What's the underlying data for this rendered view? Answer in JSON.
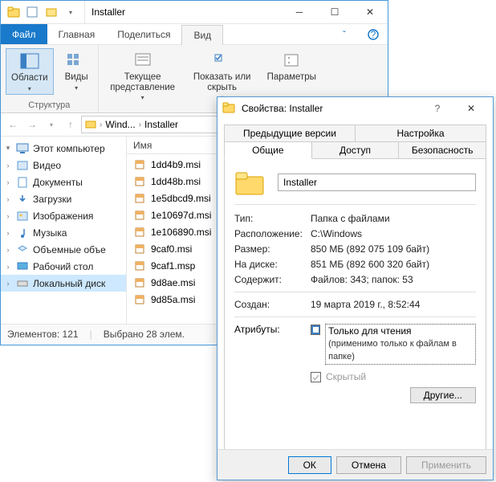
{
  "titlebar": {
    "title": "Installer"
  },
  "menu": {
    "file": "Файл",
    "tabs": [
      "Главная",
      "Поделиться",
      "Вид"
    ],
    "active_tab": 2
  },
  "ribbon": {
    "groups": [
      {
        "name": "Структура",
        "buttons": [
          {
            "label": "Области",
            "dd": true,
            "active": true
          },
          {
            "label": "Виды",
            "dd": true
          }
        ]
      },
      {
        "name": "",
        "buttons": [
          {
            "label": "Текущее представление",
            "dd": true
          },
          {
            "label": "Показать или скрыть",
            "dd": true
          },
          {
            "label": "Параметры",
            "dd": false
          }
        ]
      }
    ]
  },
  "breadcrumbs": [
    "Wind...",
    "Installer"
  ],
  "nav": [
    {
      "label": "Этот компьютер",
      "icon": "pc",
      "expand": "open"
    },
    {
      "label": "Видео",
      "icon": "video"
    },
    {
      "label": "Документы",
      "icon": "docs"
    },
    {
      "label": "Загрузки",
      "icon": "down"
    },
    {
      "label": "Изображения",
      "icon": "img"
    },
    {
      "label": "Музыка",
      "icon": "music"
    },
    {
      "label": "Объемные объе",
      "icon": "obj"
    },
    {
      "label": "Рабочий стол",
      "icon": "desk"
    },
    {
      "label": "Локальный диск",
      "icon": "disk",
      "sel": true
    }
  ],
  "column_header": "Имя",
  "files": [
    "1dd4b9.msi",
    "1dd48b.msi",
    "1e5dbcd9.msi",
    "1e10697d.msi",
    "1e106890.msi",
    "9caf0.msi",
    "9caf1.msp",
    "9d8ae.msi",
    "9d85a.msi"
  ],
  "status": {
    "elements": "Элементов: 121",
    "selected": "Выбрано 28 элем."
  },
  "props": {
    "title": "Свойства: Installer",
    "tabs_row1": [
      "Предыдущие версии",
      "Настройка"
    ],
    "tabs_row2": [
      "Общие",
      "Доступ",
      "Безопасность"
    ],
    "active_tab": "Общие",
    "name": "Installer",
    "rows": {
      "type_k": "Тип:",
      "type_v": "Папка с файлами",
      "loc_k": "Расположение:",
      "loc_v": "C:\\Windows",
      "size_k": "Размер:",
      "size_v": "850 МБ (892 075 109 байт)",
      "disk_k": "На диске:",
      "disk_v": "851 МБ (892 600 320 байт)",
      "cont_k": "Содержит:",
      "cont_v": "Файлов: 343; папок: 53",
      "created_k": "Создан:",
      "created_v": "19 марта 2019 г., 8:52:44"
    },
    "attrs": {
      "label": "Атрибуты:",
      "readonly": "Только для чтения",
      "readonly_note": "(применимо только к файлам в папке)",
      "hidden": "Скрытый",
      "other": "Другие..."
    },
    "buttons": {
      "ok": "ОК",
      "cancel": "Отмена",
      "apply": "Применить"
    }
  }
}
